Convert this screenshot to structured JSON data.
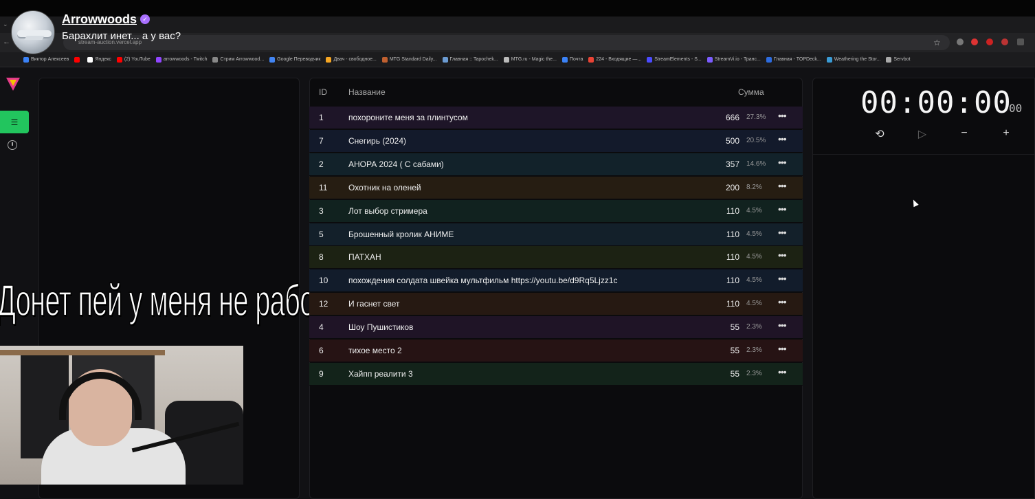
{
  "stream": {
    "channel": "Arrowwoods",
    "title": "Барахлит инет... а у вас?",
    "donate_overlay": "Донет пей у меня не работает"
  },
  "browser": {
    "url": "stream-auction.vercel.app",
    "bookmarks": [
      {
        "label": "Виктор Алексеев",
        "color": "#3b82f6"
      },
      {
        "label": "",
        "color": "#ff0000"
      },
      {
        "label": "Яндекс",
        "color": "#ffffff"
      },
      {
        "label": "(2) YouTube",
        "color": "#ff0000"
      },
      {
        "label": "arrowwoods - Twitch",
        "color": "#9146ff"
      },
      {
        "label": "Стрим Arrowwood...",
        "color": "#888888"
      },
      {
        "label": "Google Переводчик",
        "color": "#4285f4"
      },
      {
        "label": "Двач - свободное...",
        "color": "#f5a623"
      },
      {
        "label": "MTG Standard Daily...",
        "color": "#c06030"
      },
      {
        "label": "Главная :: Tapochek...",
        "color": "#6b9bd2"
      },
      {
        "label": "MTG.ru - Magic the...",
        "color": "#bbbbbb"
      },
      {
        "label": "Почта",
        "color": "#3b82f6"
      },
      {
        "label": "224 - Входящие —...",
        "color": "#ea4335"
      },
      {
        "label": "StreamElements - S...",
        "color": "#4b4bff"
      },
      {
        "label": "StreamVi.io - Транс...",
        "color": "#7b5cff"
      },
      {
        "label": "Главная - TOPDeck...",
        "color": "#2d6cdf"
      },
      {
        "label": "Weathering the Stor...",
        "color": "#3a9bd5"
      },
      {
        "label": "Servbot",
        "color": "#aaaaaa"
      }
    ]
  },
  "table": {
    "headers": {
      "id": "ID",
      "name": "Название",
      "amount": "Сумма"
    },
    "rows": [
      {
        "id": "1",
        "name": "похороните меня за плинтусом",
        "amount": "666",
        "pct": "27.3%",
        "bg": "#1e1528"
      },
      {
        "id": "7",
        "name": "Снегирь (2024)",
        "amount": "500",
        "pct": "20.5%",
        "bg": "#131a2b"
      },
      {
        "id": "2",
        "name": "АНОРА 2024 ( С сабами)",
        "amount": "357",
        "pct": "14.6%",
        "bg": "#12222a"
      },
      {
        "id": "11",
        "name": "Охотник на оленей",
        "amount": "200",
        "pct": "8.2%",
        "bg": "#261d12"
      },
      {
        "id": "3",
        "name": "Лот выбор стримера",
        "amount": "110",
        "pct": "4.5%",
        "bg": "#11221f"
      },
      {
        "id": "5",
        "name": "Брошенный кролик АНИМЕ",
        "amount": "110",
        "pct": "4.5%",
        "bg": "#13202a"
      },
      {
        "id": "8",
        "name": "ПАТХАН",
        "amount": "110",
        "pct": "4.5%",
        "bg": "#1c2213"
      },
      {
        "id": "10",
        "name": "похождения солдата швейка мультфильм https://youtu.be/d9Rq5Ljzz1c",
        "amount": "110",
        "pct": "4.5%",
        "bg": "#121c2b"
      },
      {
        "id": "12",
        "name": "И гаснет свет",
        "amount": "110",
        "pct": "4.5%",
        "bg": "#261912"
      },
      {
        "id": "4",
        "name": "Шоу Пушистиков",
        "amount": "55",
        "pct": "2.3%",
        "bg": "#1f1426"
      },
      {
        "id": "6",
        "name": "тихое место 2",
        "amount": "55",
        "pct": "2.3%",
        "bg": "#261314"
      },
      {
        "id": "9",
        "name": "Хайпп реалити 3",
        "amount": "55",
        "pct": "2.3%",
        "bg": "#13231a"
      }
    ],
    "more_symbol": "•••"
  },
  "timer": {
    "main": "00:00:00",
    "ms": "00"
  },
  "colors": {
    "accent_green": "#22c55e",
    "twitch_purple": "#a970ff"
  }
}
